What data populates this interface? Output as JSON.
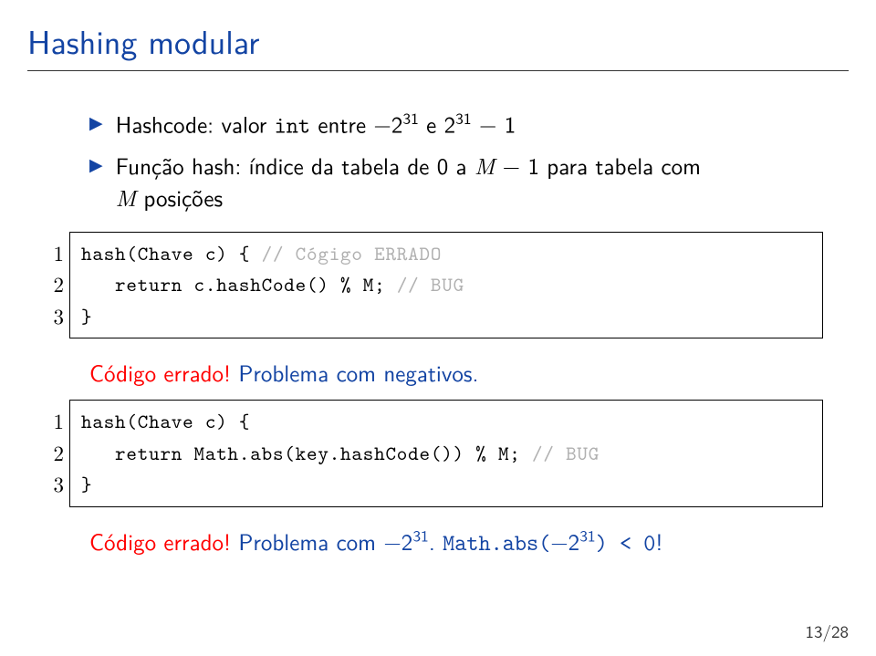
{
  "title": "Hashing modular",
  "bullets": [
    {
      "pre": "Hashcode: valor ",
      "tt": "int",
      "post_a": " entre −2",
      "sup1": "31",
      "mid": " e 2",
      "sup2": "31",
      "post_b": " − 1"
    },
    {
      "pre": "Função hash: índice da tabela de 0 a ",
      "it1": "M",
      "mid": " − 1 para tabela com",
      "br_pre": "",
      "it2": "M",
      "post": " posições"
    }
  ],
  "code1": {
    "linenos": [
      "1",
      "2",
      "3"
    ],
    "l1a": "hash(Chave c) { ",
    "l1b": "// Cógigo ERRADO",
    "l2a": "   return c.hashCode() % M; ",
    "l2b": "// BUG",
    "l3": "}"
  },
  "para1": {
    "red": "Código errado!",
    "rest": " Problema com negativos."
  },
  "code2": {
    "linenos": [
      "1",
      "2",
      "3"
    ],
    "l1": "hash(Chave c) {",
    "l2a": "   return Math.abs(key.hashCode()) % M; ",
    "l2b": "// BUG",
    "l3": "}"
  },
  "para2": {
    "red": "Código errado!",
    "rest_a": " Problema com −2",
    "sup1": "31",
    "rest_b": ". ",
    "tt_a": "Math.abs(",
    "tt_mid": "−2",
    "tt_sup": "31",
    "tt_b": ") < 0",
    "rest_c": "!"
  },
  "footer": "13/28"
}
